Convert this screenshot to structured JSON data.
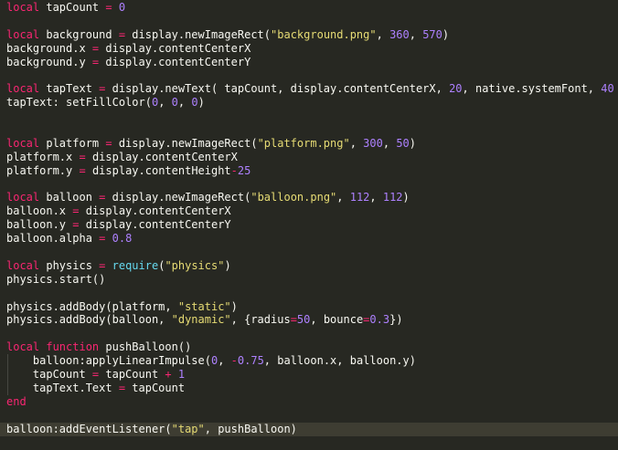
{
  "editor": {
    "colors": {
      "background": "#272822",
      "keyword": "#f92672",
      "number": "#ae81ff",
      "string": "#e6db74",
      "builtin": "#66d9ef",
      "text": "#f8f8f2",
      "current_line": "#3e3d32"
    },
    "lines": [
      {
        "indent": false,
        "tokens": [
          [
            "kw",
            "local"
          ],
          [
            "plain",
            " tapCount "
          ],
          [
            "kw",
            "="
          ],
          [
            "plain",
            " "
          ],
          [
            "num",
            "0"
          ]
        ]
      },
      {
        "indent": false,
        "tokens": []
      },
      {
        "indent": false,
        "tokens": [
          [
            "kw",
            "local"
          ],
          [
            "plain",
            " background "
          ],
          [
            "kw",
            "="
          ],
          [
            "plain",
            " display.newImageRect("
          ],
          [
            "str",
            "\"background.png\""
          ],
          [
            "plain",
            ", "
          ],
          [
            "num",
            "360"
          ],
          [
            "plain",
            ", "
          ],
          [
            "num",
            "570"
          ],
          [
            "plain",
            ")"
          ]
        ]
      },
      {
        "indent": false,
        "tokens": [
          [
            "plain",
            "background.x "
          ],
          [
            "kw",
            "="
          ],
          [
            "plain",
            " display.contentCenterX"
          ]
        ]
      },
      {
        "indent": false,
        "tokens": [
          [
            "plain",
            "background.y "
          ],
          [
            "kw",
            "="
          ],
          [
            "plain",
            " display.contentCenterY"
          ]
        ]
      },
      {
        "indent": false,
        "tokens": []
      },
      {
        "indent": false,
        "tokens": [
          [
            "kw",
            "local"
          ],
          [
            "plain",
            " tapText "
          ],
          [
            "kw",
            "="
          ],
          [
            "plain",
            " display.newText( tapCount, display.contentCenterX, "
          ],
          [
            "num",
            "20"
          ],
          [
            "plain",
            ", native.systemFont, "
          ],
          [
            "num",
            "40"
          ],
          [
            "plain",
            " )"
          ]
        ]
      },
      {
        "indent": false,
        "tokens": [
          [
            "plain",
            "tapText: setFillColor("
          ],
          [
            "num",
            "0"
          ],
          [
            "plain",
            ", "
          ],
          [
            "num",
            "0"
          ],
          [
            "plain",
            ", "
          ],
          [
            "num",
            "0"
          ],
          [
            "plain",
            ")"
          ]
        ]
      },
      {
        "indent": false,
        "tokens": []
      },
      {
        "indent": false,
        "tokens": []
      },
      {
        "indent": false,
        "tokens": [
          [
            "kw",
            "local"
          ],
          [
            "plain",
            " platform "
          ],
          [
            "kw",
            "="
          ],
          [
            "plain",
            " display.newImageRect("
          ],
          [
            "str",
            "\"platform.png\""
          ],
          [
            "plain",
            ", "
          ],
          [
            "num",
            "300"
          ],
          [
            "plain",
            ", "
          ],
          [
            "num",
            "50"
          ],
          [
            "plain",
            ")"
          ]
        ]
      },
      {
        "indent": false,
        "tokens": [
          [
            "plain",
            "platform.x "
          ],
          [
            "kw",
            "="
          ],
          [
            "plain",
            " display.contentCenterX"
          ]
        ]
      },
      {
        "indent": false,
        "tokens": [
          [
            "plain",
            "platform.y "
          ],
          [
            "kw",
            "="
          ],
          [
            "plain",
            " display.contentHeight"
          ],
          [
            "kw",
            "-"
          ],
          [
            "num",
            "25"
          ]
        ]
      },
      {
        "indent": false,
        "tokens": []
      },
      {
        "indent": false,
        "tokens": [
          [
            "kw",
            "local"
          ],
          [
            "plain",
            " balloon "
          ],
          [
            "kw",
            "="
          ],
          [
            "plain",
            " display.newImageRect("
          ],
          [
            "str",
            "\"balloon.png\""
          ],
          [
            "plain",
            ", "
          ],
          [
            "num",
            "112"
          ],
          [
            "plain",
            ", "
          ],
          [
            "num",
            "112"
          ],
          [
            "plain",
            ")"
          ]
        ]
      },
      {
        "indent": false,
        "tokens": [
          [
            "plain",
            "balloon.x "
          ],
          [
            "kw",
            "="
          ],
          [
            "plain",
            " display.contentCenterX"
          ]
        ]
      },
      {
        "indent": false,
        "tokens": [
          [
            "plain",
            "balloon.y "
          ],
          [
            "kw",
            "="
          ],
          [
            "plain",
            " display.contentCenterY"
          ]
        ]
      },
      {
        "indent": false,
        "tokens": [
          [
            "plain",
            "balloon.alpha "
          ],
          [
            "kw",
            "="
          ],
          [
            "plain",
            " "
          ],
          [
            "num",
            "0.8"
          ]
        ]
      },
      {
        "indent": false,
        "tokens": []
      },
      {
        "indent": false,
        "tokens": [
          [
            "kw",
            "local"
          ],
          [
            "plain",
            " physics "
          ],
          [
            "kw",
            "="
          ],
          [
            "plain",
            " "
          ],
          [
            "fn",
            "require"
          ],
          [
            "plain",
            "("
          ],
          [
            "str",
            "\"physics\""
          ],
          [
            "plain",
            ")"
          ]
        ]
      },
      {
        "indent": false,
        "tokens": [
          [
            "plain",
            "physics.start()"
          ]
        ]
      },
      {
        "indent": false,
        "tokens": []
      },
      {
        "indent": false,
        "tokens": [
          [
            "plain",
            "physics.addBody(platform, "
          ],
          [
            "str",
            "\"static\""
          ],
          [
            "plain",
            ")"
          ]
        ]
      },
      {
        "indent": false,
        "tokens": [
          [
            "plain",
            "physics.addBody(balloon, "
          ],
          [
            "str",
            "\"dynamic\""
          ],
          [
            "plain",
            ", {radius"
          ],
          [
            "kw",
            "="
          ],
          [
            "num",
            "50"
          ],
          [
            "plain",
            ", bounce"
          ],
          [
            "kw",
            "="
          ],
          [
            "num",
            "0.3"
          ],
          [
            "plain",
            "})"
          ]
        ]
      },
      {
        "indent": false,
        "tokens": []
      },
      {
        "indent": false,
        "tokens": [
          [
            "kw",
            "local"
          ],
          [
            "plain",
            " "
          ],
          [
            "kw",
            "function"
          ],
          [
            "plain",
            " pushBalloon()"
          ]
        ]
      },
      {
        "indent": true,
        "tokens": [
          [
            "plain",
            "    balloon:applyLinearImpulse("
          ],
          [
            "num",
            "0"
          ],
          [
            "plain",
            ", "
          ],
          [
            "kw",
            "-"
          ],
          [
            "num",
            "0.75"
          ],
          [
            "plain",
            ", balloon.x, balloon.y)"
          ]
        ]
      },
      {
        "indent": true,
        "tokens": [
          [
            "plain",
            "    tapCount "
          ],
          [
            "kw",
            "="
          ],
          [
            "plain",
            " tapCount "
          ],
          [
            "kw",
            "+"
          ],
          [
            "plain",
            " "
          ],
          [
            "num",
            "1"
          ]
        ]
      },
      {
        "indent": true,
        "tokens": [
          [
            "plain",
            "    tapText.Text "
          ],
          [
            "kw",
            "="
          ],
          [
            "plain",
            " tapCount"
          ]
        ]
      },
      {
        "indent": false,
        "tokens": [
          [
            "kw",
            "end"
          ]
        ]
      },
      {
        "indent": false,
        "tokens": []
      },
      {
        "indent": false,
        "current": true,
        "tokens": [
          [
            "plain",
            "balloon:addEventListener("
          ],
          [
            "str",
            "\"tap\""
          ],
          [
            "plain",
            ", pushBalloon)"
          ]
        ]
      }
    ]
  }
}
